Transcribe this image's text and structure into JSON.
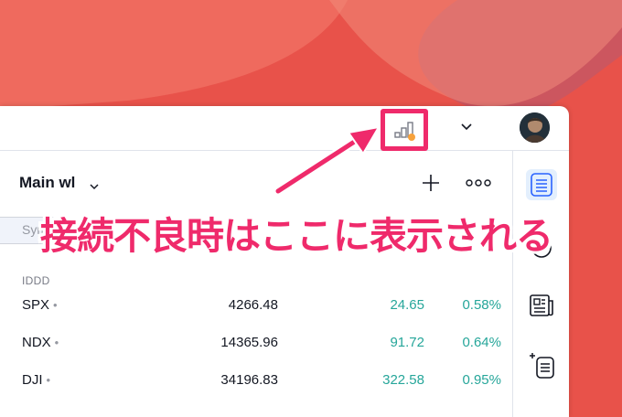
{
  "wallpaper": {
    "colors": [
      "#e8524a",
      "#2d6fd8",
      "#f2f4f8"
    ]
  },
  "topbar": {
    "connection_icon": "connection-warning-icon",
    "chevron_icon": "chevron-down-icon",
    "avatar": "user-avatar"
  },
  "watchlist": {
    "title": "Main wl",
    "search_placeholder": "Sym",
    "section_label": "IDDD",
    "rows": [
      {
        "symbol": "SPX",
        "last": "4266.48",
        "change": "24.65",
        "change_pct": "0.58%"
      },
      {
        "symbol": "NDX",
        "last": "14365.96",
        "change": "91.72",
        "change_pct": "0.64%"
      },
      {
        "symbol": "DJI",
        "last": "34196.83",
        "change": "322.58",
        "change_pct": "0.95%"
      }
    ],
    "dot": "•"
  },
  "sidebar": {
    "items": [
      "watchlist-icon",
      "alerts-icon",
      "news-icon",
      "ideas-icon"
    ]
  },
  "annotation": {
    "text": "接続不良時はここに表示される"
  },
  "colors": {
    "accent": "#ef2a6b",
    "positive": "#26a69a",
    "active": "#2962ff"
  }
}
